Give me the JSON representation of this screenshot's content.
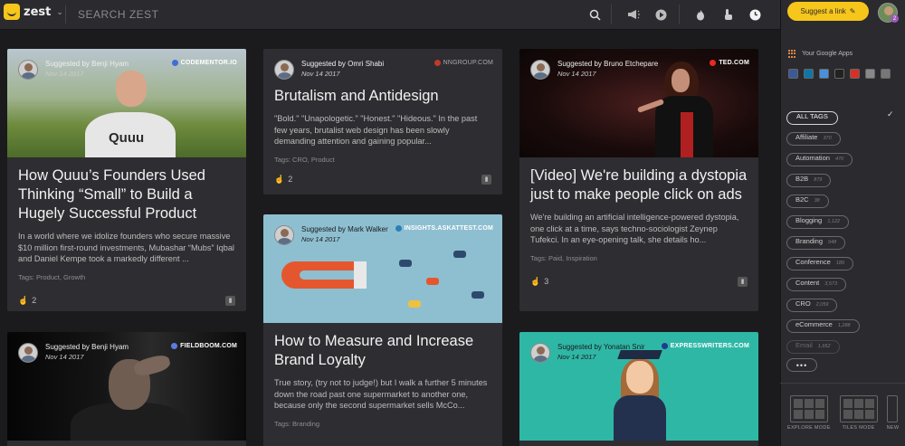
{
  "app": {
    "logo_text": "zest"
  },
  "search": {
    "placeholder": "SEARCH ZEST"
  },
  "toolbar": {
    "suggest_label": "Suggest a link",
    "user_badge": "2"
  },
  "cards": [
    {
      "suggested_by": "Suggested by Benji Hyam",
      "date": "Nov 14 2017",
      "source": "CODEMENTOR.IO",
      "title": "How Quuu’s Founders Used Thinking “Small” to Build a Hugely Successful Product",
      "desc": "In a world where we idolize founders who secure massive $10 million first-round investments, Mubashar “Mubs” Iqbal and Daniel Kempe took a markedly different ...",
      "tags": "Tags: Product, Growth",
      "likes": "2"
    },
    {
      "suggested_by": "Suggested by Omri Shabi",
      "date": "Nov 14 2017",
      "source": "NNGROUP.COM",
      "title": "Brutalism and Antidesign",
      "desc": "\"Bold.\" \"Unapologetic.\" \"Honest.\" \"Hideous.\" In the past few years, brutalist web design has been slowly demanding attention and gaining popular...",
      "tags": "Tags: CRO, Product",
      "likes": "2"
    },
    {
      "suggested_by": "Suggested by Bruno Etchepare",
      "date": "Nov 14 2017",
      "source": "TED.COM",
      "title": "[Video] We're building a dystopia just to make people click on ads",
      "desc": "We're building an artificial intelligence-powered dystopia, one click at a time, says techno-sociologist Zeynep Tufekci. In an eye-opening talk, she details ho...",
      "tags": "Tags: Paid, Inspiration",
      "likes": "3"
    },
    {
      "suggested_by": "Suggested by Mark Walker",
      "date": "Nov 14 2017",
      "source": "INSIGHTS.ASKATTEST.COM",
      "title": "How to Measure and Increase Brand Loyalty",
      "desc": "True story, (try not to judge!) but I walk a further 5 minutes down the road past one supermarket to another one, because only the second supermarket sells McCo...",
      "tags": "Tags: Branding",
      "likes": ""
    },
    {
      "suggested_by": "Suggested by Benji Hyam",
      "date": "Nov 14 2017",
      "source": "FIELDBOOM.COM"
    },
    {
      "suggested_by": "Suggested by Yonatan Snir",
      "date": "Nov 14 2017",
      "source": "EXPRESSWRITERS.COM"
    }
  ],
  "sidebar": {
    "google_apps_label": "Your Google Apps",
    "all_tags": "ALL TAGS",
    "tags": [
      {
        "name": "Affiliate",
        "count": "370"
      },
      {
        "name": "Automation",
        "count": "470"
      },
      {
        "name": "B2B",
        "count": "879"
      },
      {
        "name": "B2C",
        "count": "38"
      },
      {
        "name": "Blogging",
        "count": "1,122"
      },
      {
        "name": "Branding",
        "count": "948"
      },
      {
        "name": "Conference",
        "count": "189"
      },
      {
        "name": "Content",
        "count": "3,573"
      },
      {
        "name": "CRO",
        "count": "2,059"
      },
      {
        "name": "eCommerce",
        "count": "1,288"
      },
      {
        "name": "Email",
        "count": "1,652"
      }
    ],
    "more_label": "•••",
    "modes": [
      "EXPLORE MODE",
      "TILES MODE",
      "NEW"
    ]
  }
}
